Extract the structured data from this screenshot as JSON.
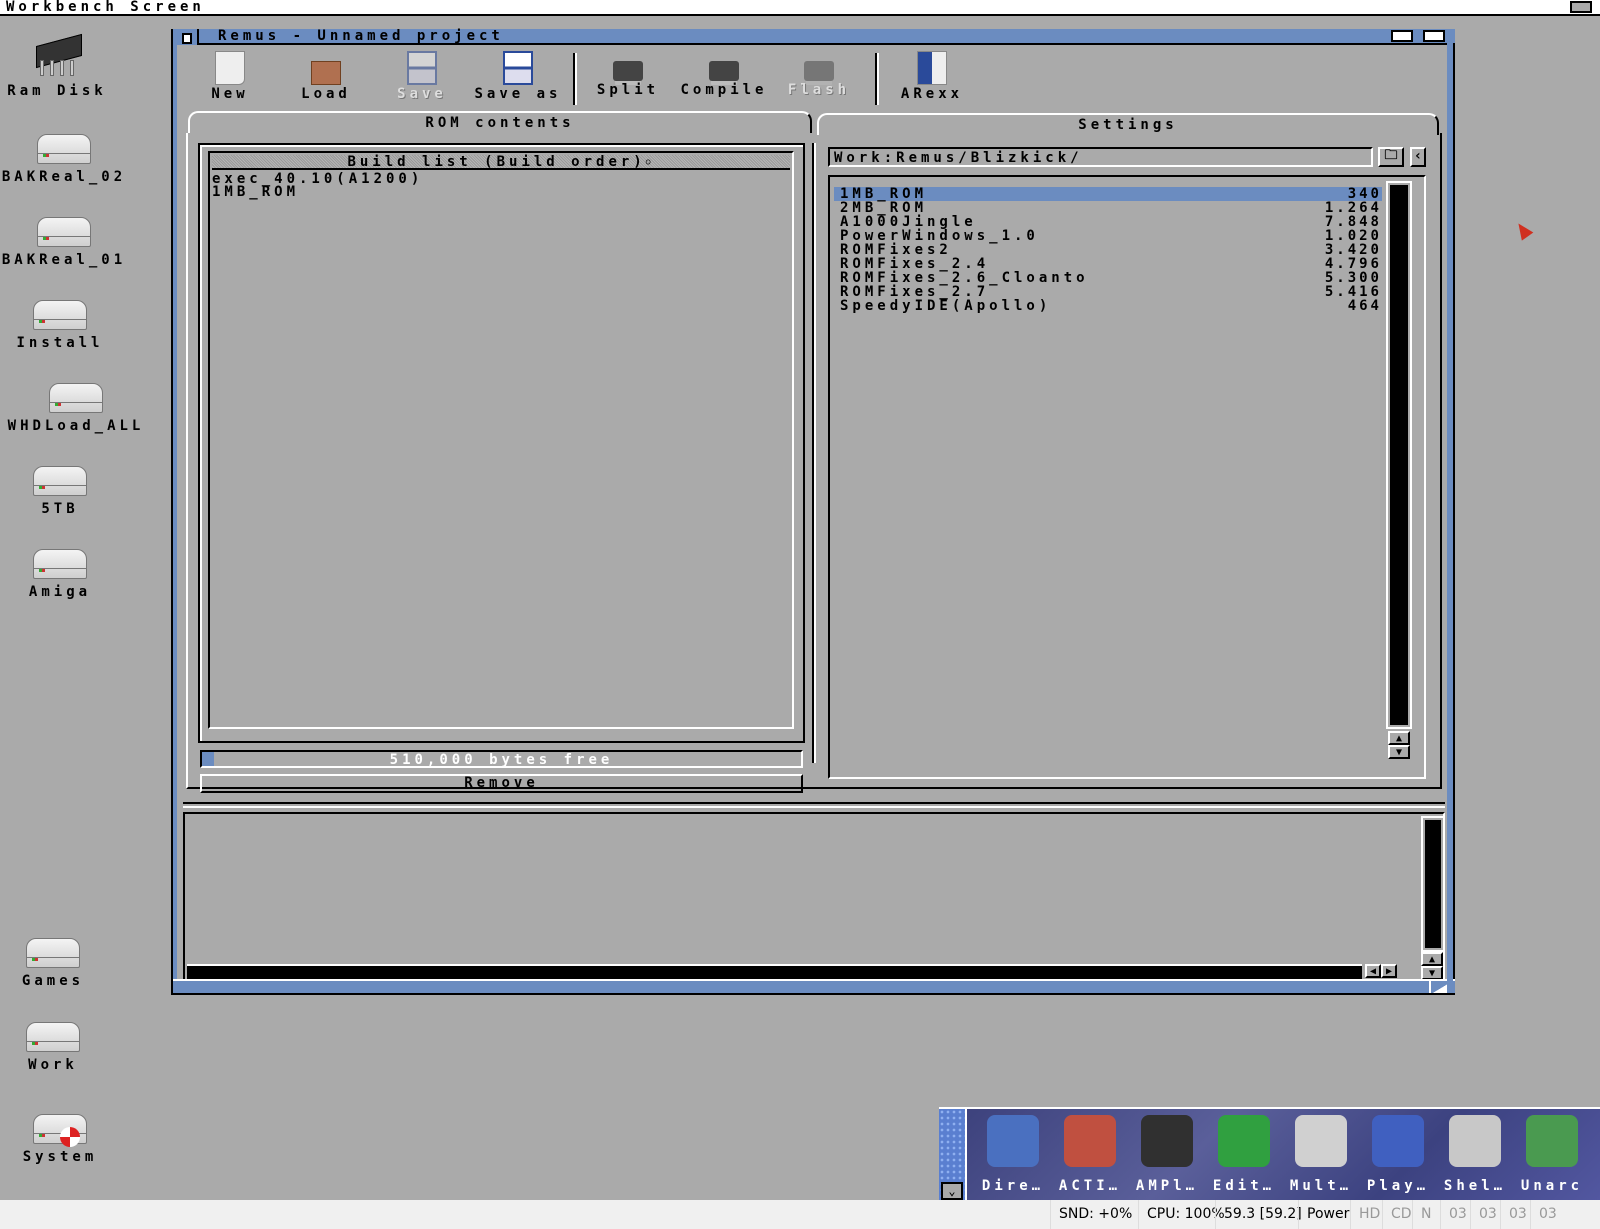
{
  "screen": {
    "title": "Workbench Screen"
  },
  "desktop_icons": [
    {
      "label": "Ram Disk",
      "icon": "ram-chip-icon"
    },
    {
      "label": "BAKReal_02",
      "icon": "hard-drive-icon"
    },
    {
      "label": "BAKReal_01",
      "icon": "hard-drive-icon"
    },
    {
      "label": "Install",
      "icon": "hard-drive-icon"
    },
    {
      "label": "WHDLoad_ALL",
      "icon": "hard-drive-icon"
    },
    {
      "label": "5TB",
      "icon": "hard-drive-icon"
    },
    {
      "label": "Amiga",
      "icon": "hard-drive-icon"
    },
    {
      "label": "Games",
      "icon": "hard-drive-icon"
    },
    {
      "label": "Work",
      "icon": "hard-drive-icon"
    },
    {
      "label": "System",
      "icon": "system-drive-icon"
    }
  ],
  "window": {
    "title": "Remus - Unnamed project",
    "toolbar": [
      {
        "label": "New",
        "icon": "new-document-icon",
        "enabled": true
      },
      {
        "label": "Load",
        "icon": "folder-icon",
        "enabled": true
      },
      {
        "label": "Save",
        "icon": "floppy-icon",
        "enabled": false
      },
      {
        "label": "Save as",
        "icon": "floppy-icon",
        "enabled": true
      },
      {
        "label": "Split",
        "icon": "chip-icon",
        "enabled": true
      },
      {
        "label": "Compile",
        "icon": "chip-icon",
        "enabled": true
      },
      {
        "label": "Flash",
        "icon": "chip-icon",
        "enabled": false
      },
      {
        "label": "ARexx",
        "icon": "arexx-icon",
        "enabled": true
      }
    ],
    "tabs": [
      {
        "label": "ROM contents",
        "active": true
      },
      {
        "label": "Settings",
        "active": false
      }
    ],
    "build_list": {
      "header": "Build list (Build order)",
      "items": [
        "exec_40.10(A1200)",
        "1MB_ROM"
      ]
    },
    "free_bar": {
      "text": "510,000 bytes free",
      "used_fraction": 0.02
    },
    "remove_button": "Remove",
    "path": "Work:Remus/Blizkick/",
    "files": [
      {
        "name": "1MB_ROM",
        "size": "340",
        "selected": true
      },
      {
        "name": "2MB_ROM",
        "size": "1.264"
      },
      {
        "name": "A1000Jingle",
        "size": "7.848"
      },
      {
        "name": "PowerWindows_1.0",
        "size": "1.020"
      },
      {
        "name": "ROMFixes2",
        "size": "3.420"
      },
      {
        "name": "ROMFixes_2.4",
        "size": "4.796"
      },
      {
        "name": "ROMFixes_2.6_Cloanto",
        "size": "5.300"
      },
      {
        "name": "ROMFixes_2.7",
        "size": "5.416"
      },
      {
        "name": "SpeedyIDE(Apollo)",
        "size": "464"
      }
    ]
  },
  "dock": [
    {
      "label": "Dire…",
      "icon": "directory-opus-icon",
      "color": "#4a70c0"
    },
    {
      "label": "ACTI…",
      "icon": "film-window-icon",
      "color": "#c05040"
    },
    {
      "label": "AMPl…",
      "icon": "speaker-icon",
      "color": "#303030"
    },
    {
      "label": "Edit…",
      "icon": "notepad-icon",
      "color": "#30a040"
    },
    {
      "label": "Mult…",
      "icon": "magnifier-icon",
      "color": "#d0d0d0"
    },
    {
      "label": "Play…",
      "icon": "player-icon",
      "color": "#4060c0"
    },
    {
      "label": "Shel…",
      "icon": "shell-window-icon",
      "color": "#c8c8c8"
    },
    {
      "label": "Unarc",
      "icon": "cube-icon",
      "color": "#4a9a50"
    }
  ],
  "statusbar": [
    {
      "text": "SND: +0%"
    },
    {
      "text": "CPU: 100%"
    },
    {
      "text": "59.3 [59.2]"
    },
    {
      "text": "Power"
    },
    {
      "text": "HD",
      "dim": true
    },
    {
      "text": "CD",
      "dim": true
    },
    {
      "text": "N",
      "dim": true
    },
    {
      "text": "03",
      "dim": true
    },
    {
      "text": "03",
      "dim": true
    },
    {
      "text": "03",
      "dim": true
    },
    {
      "text": "03",
      "dim": true
    }
  ],
  "colors": {
    "accent": "#6b8cc0",
    "background": "#aaaaaa"
  }
}
